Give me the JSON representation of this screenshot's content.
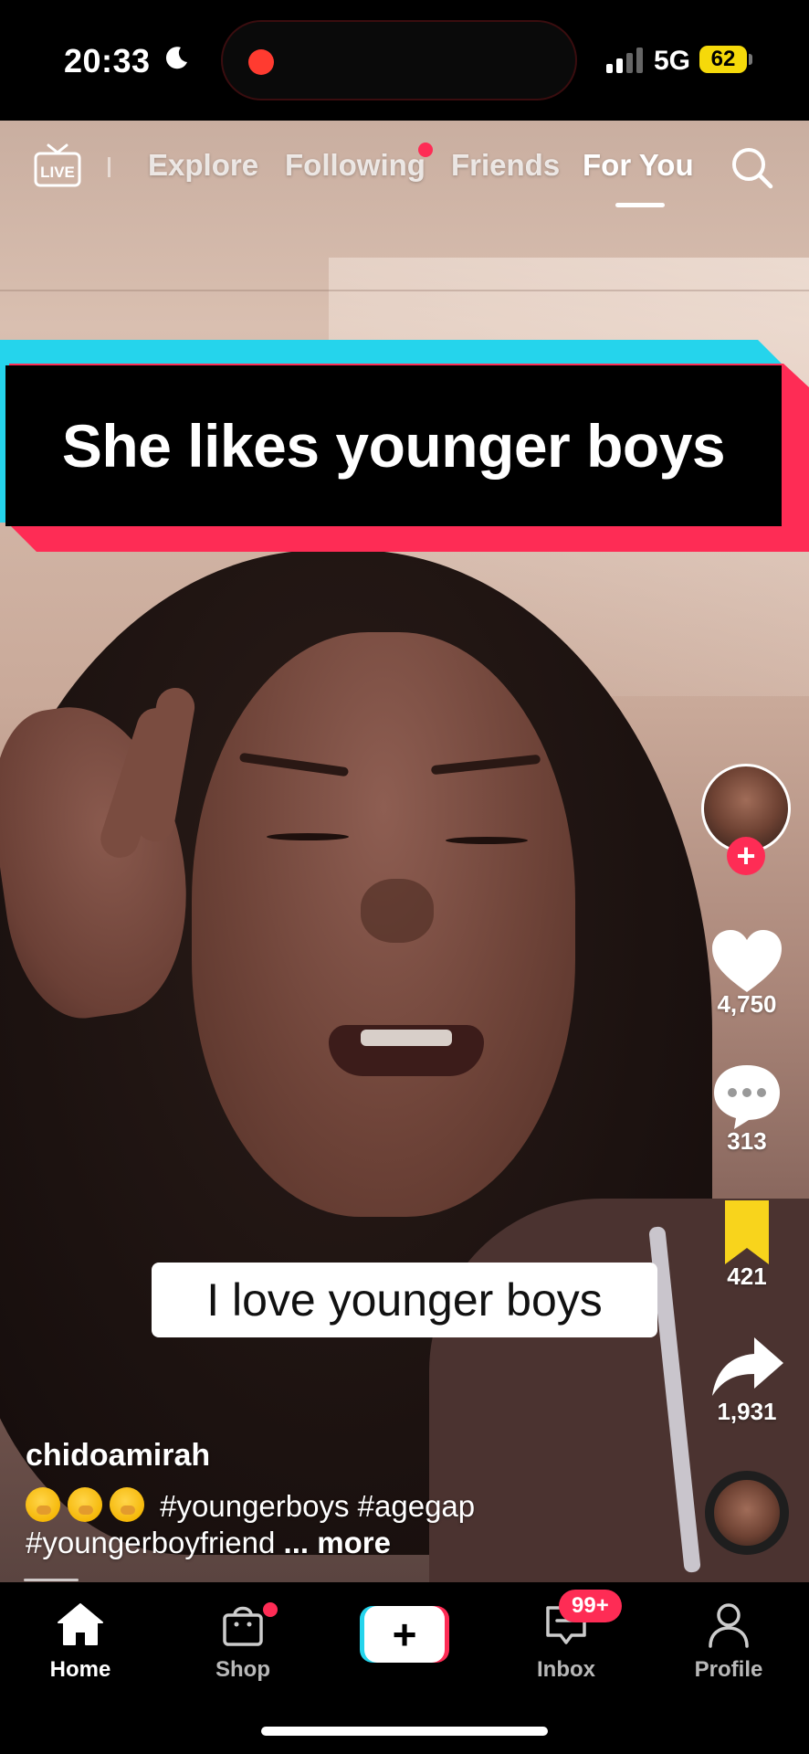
{
  "status_bar": {
    "time": "20:33",
    "network": "5G",
    "battery": "62",
    "icons": [
      "moon-icon",
      "recording-dot",
      "signal-icon",
      "battery-icon"
    ]
  },
  "top_nav": {
    "live_label": "LIVE",
    "tabs": [
      {
        "label": "Explore",
        "active": false
      },
      {
        "label": "Following",
        "active": false,
        "has_dot": true
      },
      {
        "label": "Friends",
        "active": false
      },
      {
        "label": "For You",
        "active": true
      }
    ],
    "search_icon": "search-icon"
  },
  "video": {
    "title_banner": "She likes younger boys",
    "caption_subtitle": "I love younger boys"
  },
  "actions": {
    "likes": "4,750",
    "comments": "313",
    "bookmarks": "421",
    "shares": "1,931",
    "follow_icon": "plus-icon"
  },
  "post": {
    "username": "chidoamirah",
    "hashtags_line1": "#youngerboys #agegap",
    "hashtags_line2": "#youngerboyfriend",
    "more_label": "... more",
    "emoji": "hand-over-mouth-emoji"
  },
  "bottom_nav": {
    "items": [
      {
        "label": "Home",
        "icon": "home-icon",
        "active": true
      },
      {
        "label": "Shop",
        "icon": "shop-bag-icon",
        "active": false,
        "has_dot": true
      },
      {
        "label": "",
        "icon": "create-plus-icon",
        "active": false
      },
      {
        "label": "Inbox",
        "icon": "inbox-icon",
        "active": false,
        "badge": "99+"
      },
      {
        "label": "Profile",
        "icon": "profile-icon",
        "active": false
      }
    ]
  },
  "colors": {
    "accent_red": "#fe2c55",
    "accent_cyan": "#25d4ec",
    "bookmark_yellow": "#f8d41c",
    "battery_yellow": "#f5d90a"
  }
}
